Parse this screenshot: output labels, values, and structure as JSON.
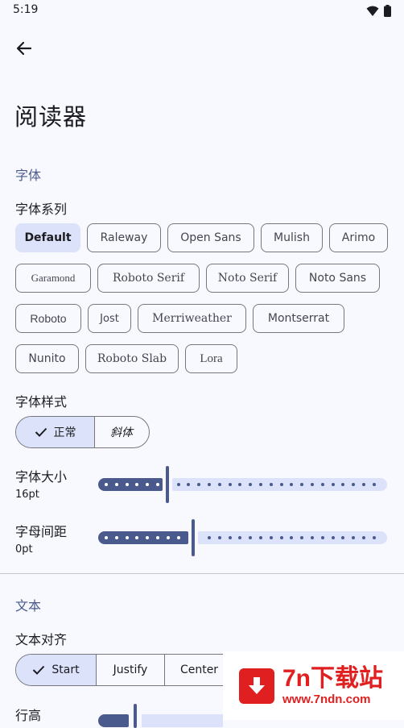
{
  "status": {
    "time": "5:19"
  },
  "header": {
    "title": "阅读器"
  },
  "font_section": {
    "title": "字体",
    "family_label": "字体系列",
    "families": [
      [
        "Default",
        "Raleway",
        "Open Sans",
        "Mulish",
        "Arimo"
      ],
      [
        "Garamond",
        "Roboto Serif",
        "Noto Serif",
        "Noto Sans"
      ],
      [
        "Roboto",
        "Jost",
        "Merriweather",
        "Montserrat"
      ],
      [
        "Nunito",
        "Roboto Slab",
        "Lora"
      ]
    ],
    "selected_family": "Default",
    "style_label": "字体样式",
    "style_options": [
      "正常",
      "斜体"
    ],
    "selected_style": "正常",
    "size_label": "字体大小",
    "size_value": "16pt",
    "size_fraction": 0.24,
    "spacing_label": "字母间距",
    "spacing_value": "0pt",
    "spacing_fraction": 0.33
  },
  "text_section": {
    "title": "文本",
    "align_label": "文本对齐",
    "align_options": [
      "Start",
      "Justify",
      "Center"
    ],
    "selected_align": "Start",
    "line_height_label": "行高"
  },
  "watermark": {
    "main": "7n下载站",
    "sub": "www.7ndn.com"
  },
  "colors": {
    "accent": "#4a5a8c",
    "selected_bg": "#dce2f9",
    "outline": "#767680",
    "background": "#f8f9ff",
    "watermark_red": "#e02020"
  }
}
